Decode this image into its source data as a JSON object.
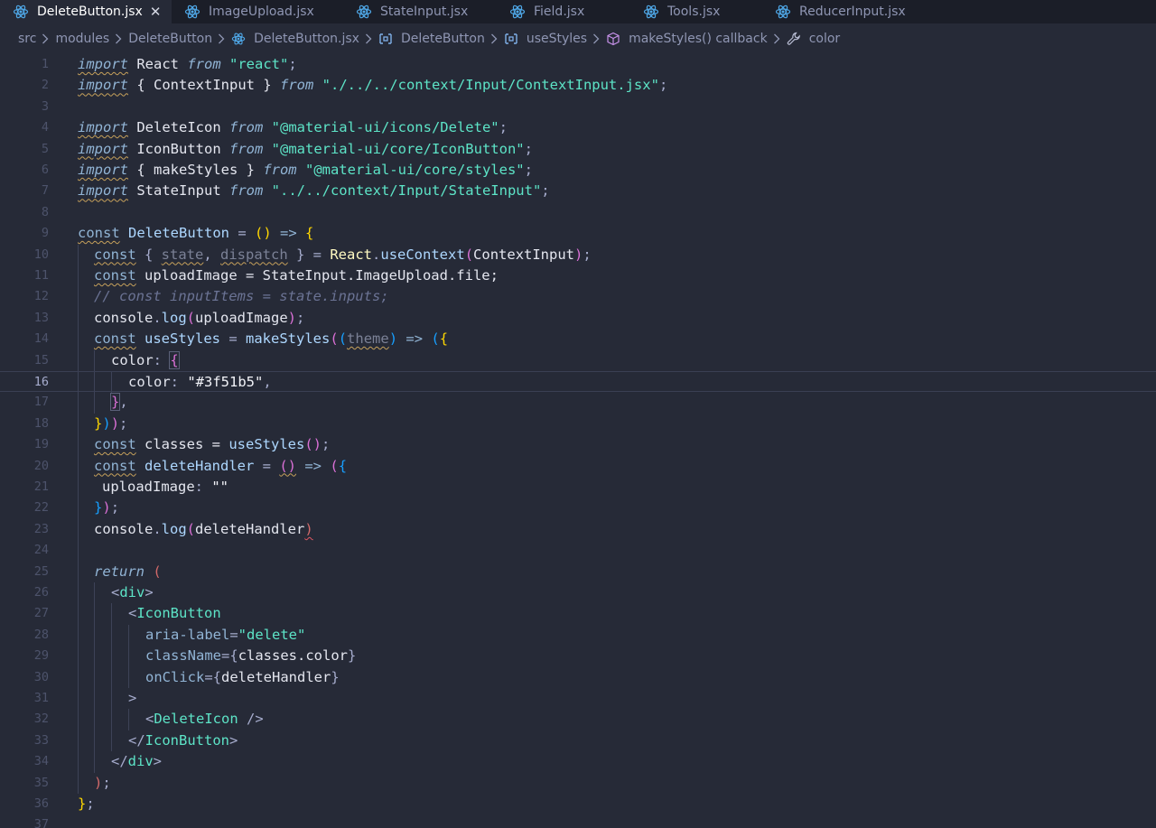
{
  "tabs": [
    {
      "label": "DeleteButton.jsx",
      "active": true
    },
    {
      "label": "ImageUpload.jsx",
      "active": false
    },
    {
      "label": "StateInput.jsx",
      "active": false
    },
    {
      "label": "Field.jsx",
      "active": false
    },
    {
      "label": "Tools.jsx",
      "active": false
    },
    {
      "label": "ReducerInput.jsx",
      "active": false
    }
  ],
  "breadcrumb": [
    "src",
    "modules",
    "DeleteButton",
    "DeleteButton.jsx",
    "DeleteButton",
    "useStyles",
    "makeStyles() callback",
    "color"
  ],
  "line_numbers": [
    "1",
    "2",
    "3",
    "4",
    "5",
    "6",
    "7",
    "8",
    "9",
    "10",
    "11",
    "12",
    "13",
    "14",
    "15",
    "16",
    "17",
    "18",
    "19",
    "20",
    "21",
    "22",
    "23",
    "24",
    "25",
    "26",
    "27",
    "28",
    "29",
    "30",
    "31",
    "32",
    "33",
    "34",
    "35",
    "36",
    "37"
  ],
  "code": {
    "l1": [
      "import",
      " React ",
      "from",
      " ",
      "\"react\"",
      ";"
    ],
    "l2": [
      "import",
      " { ContextInput } ",
      "from",
      " ",
      "\"./../../context/Input/ContextInput.jsx\"",
      ";"
    ],
    "l4": [
      "import",
      " DeleteIcon ",
      "from",
      " ",
      "\"@material-ui/icons/Delete\"",
      ";"
    ],
    "l5": [
      "import",
      " IconButton ",
      "from",
      " ",
      "\"@material-ui/core/IconButton\"",
      ";"
    ],
    "l6": [
      "import",
      " { makeStyles } ",
      "from",
      " ",
      "\"@material-ui/core/styles\"",
      ";"
    ],
    "l7": [
      "import",
      " StateInput ",
      "from",
      " ",
      "\"../../context/Input/StateInput\"",
      ";"
    ],
    "l9": [
      "const",
      " ",
      "DeleteButton",
      " = ",
      "()",
      " => ",
      "{"
    ],
    "l10": [
      "const",
      " { ",
      "state",
      ", ",
      "dispatch",
      " } = ",
      "React",
      ".",
      "useContext",
      "(",
      "ContextInput",
      ")",
      ";"
    ],
    "l11": [
      "const",
      " uploadImage = StateInput.ImageUpload.file;"
    ],
    "l12": "// const inputItems = state.inputs;",
    "l13": [
      "console",
      ".",
      "log",
      "(",
      "uploadImage",
      ")",
      ";"
    ],
    "l14": [
      "const",
      " ",
      "useStyles",
      " = ",
      "makeStyles",
      "(",
      "(",
      "theme",
      ")",
      " => ",
      "(",
      "{"
    ],
    "l15": [
      "color",
      ": ",
      "{"
    ],
    "l16": [
      "color",
      ": ",
      "\"#3f51b5\"",
      ","
    ],
    "l17": [
      "}",
      ","
    ],
    "l18": [
      "}",
      ")",
      ")",
      ";"
    ],
    "l19": [
      "const",
      " classes = ",
      "useStyles",
      "(",
      ")",
      ";"
    ],
    "l20": [
      "const",
      " ",
      "deleteHandler",
      " = ",
      "()",
      " => ",
      "(",
      "{"
    ],
    "l21": [
      "uploadImage",
      ": ",
      "\"\""
    ],
    "l22": [
      "}",
      ")",
      ";"
    ],
    "l23": [
      "console",
      ".",
      "log",
      "(",
      "deleteHandler",
      ")"
    ],
    "l25": [
      "return",
      " ",
      "("
    ],
    "l26": [
      "<",
      "div",
      ">"
    ],
    "l27": [
      "<",
      "IconButton"
    ],
    "l28": [
      "aria-label",
      "=",
      "\"delete\""
    ],
    "l29": [
      "className",
      "=",
      "{",
      "classes.color",
      "}"
    ],
    "l30": [
      "onClick",
      "=",
      "{",
      "deleteHandler",
      "}"
    ],
    "l31": [
      ">"
    ],
    "l32": [
      "<",
      "DeleteIcon",
      " />"
    ],
    "l33": [
      "</",
      "IconButton",
      ">"
    ],
    "l34": [
      "</",
      "div",
      ">"
    ],
    "l35": [
      ")",
      ";"
    ],
    "l36": [
      "}",
      ";"
    ]
  },
  "colors": {
    "background": "#262a37",
    "tabbar": "#1b1e28",
    "keyword": "#91b4d5",
    "string": "#5de4c7",
    "react_icon": "#4fa8e8"
  }
}
